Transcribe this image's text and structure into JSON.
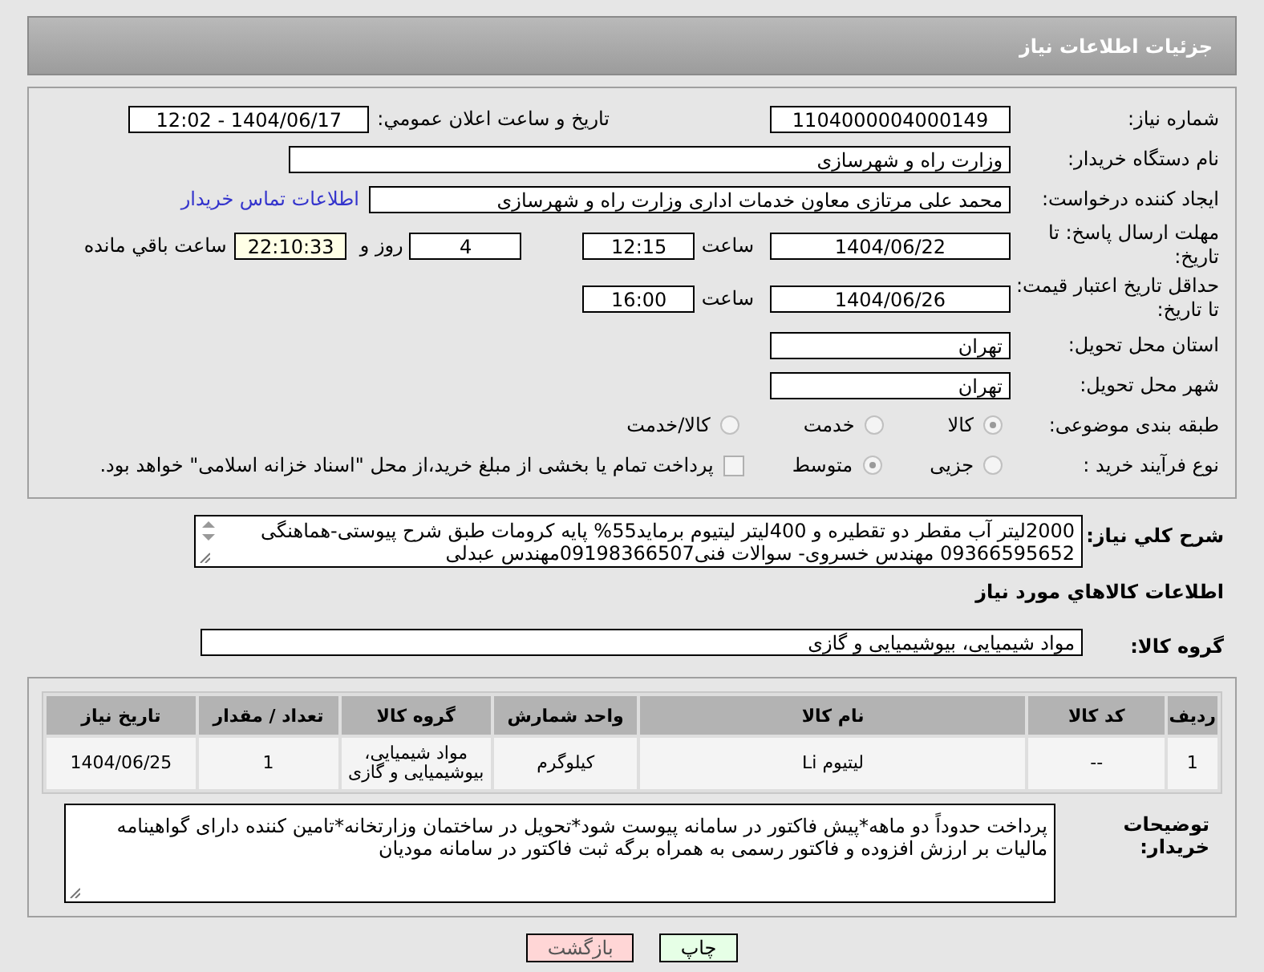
{
  "page_title": "جزئیات اطلاعات نیاز",
  "need_number": {
    "label": "شماره نیاز:",
    "value": "1104000004000149"
  },
  "announce": {
    "label": "تاریخ و ساعت اعلان عمومي:",
    "value": "1404/06/17 - 12:02"
  },
  "buyer_org": {
    "label": "نام دستگاه خریدار:",
    "value": "وزارت راه و شهرسازی"
  },
  "requester": {
    "label": "ایجاد کننده درخواست:",
    "value": "محمد علی  مرتازی معاون خدمات اداری وزارت راه و شهرسازی",
    "link": "اطلاعات تماس خریدار"
  },
  "response_deadline": {
    "label": "مهلت ارسال پاسخ: تا تاریخ:",
    "date": "1404/06/22",
    "time_label": "ساعت",
    "time": "12:15",
    "days": "4",
    "days_label": "روز و",
    "remaining": "22:10:33",
    "remaining_label": "ساعت باقي مانده"
  },
  "price_validity": {
    "label": "حداقل تاریخ اعتبار قیمت: تا تاریخ:",
    "date": "1404/06/26",
    "time_label": "ساعت",
    "time": "16:00"
  },
  "province": {
    "label": "استان محل تحویل:",
    "value": "تهران"
  },
  "city": {
    "label": "شهر محل تحویل:",
    "value": "تهران"
  },
  "category": {
    "label": "طبقه بندی موضوعی:",
    "options": [
      {
        "label": "کالا",
        "selected": true
      },
      {
        "label": "خدمت",
        "selected": false
      },
      {
        "label": "کالا/خدمت",
        "selected": false
      }
    ]
  },
  "process": {
    "label": "نوع فرآیند خرید :",
    "options": [
      {
        "label": "جزیی",
        "selected": false
      },
      {
        "label": "متوسط",
        "selected": true
      }
    ],
    "treasury": {
      "label": "پرداخت تمام یا بخشی از مبلغ خرید،از محل \"اسناد خزانه اسلامی\" خواهد بود.",
      "checked": false
    }
  },
  "description": {
    "label": "شرح کلي نیاز:",
    "value": "2000لیتر آب مقطر دو تقطیره و 400لیتر لیتیوم برماید55% پایه کرومات طبق شرح پیوستی-هماهنگی 09366595652 مهندس خسروی- سوالات فنی09198366507مهندس عبدلی"
  },
  "goods_heading": "اطلاعات کالاهاي مورد نیاز",
  "goods_group": {
    "label": "گروه کالا:",
    "value": "مواد شیمیایی، بیوشیمیایی و  گازی"
  },
  "table": {
    "columns": [
      "ردیف",
      "کد کالا",
      "نام کالا",
      "واحد شمارش",
      "گروه کالا",
      "تعداد / مقدار",
      "تاریخ نیاز"
    ],
    "rows": [
      [
        "1",
        "--",
        "لیتیوم Li",
        "کیلوگرم",
        "مواد شیمیایی، بیوشیمیایی و گازی",
        "1",
        "1404/06/25"
      ]
    ]
  },
  "buyer_notes": {
    "label": "توضیحات خریدار:",
    "value": "پرداخت حدوداً دو ماهه*پیش فاکتور در سامانه پیوست شود*تحویل در ساختمان وزارتخانه*تامین کننده دارای گواهینامه مالیات بر ارزش افزوده و فاکتور رسمی به همراه برگه ثبت فاکتور در سامانه مودیان"
  },
  "buttons": [
    {
      "label": "چاپ",
      "kind": "print"
    },
    {
      "label": "بازگشت",
      "kind": "back"
    }
  ]
}
